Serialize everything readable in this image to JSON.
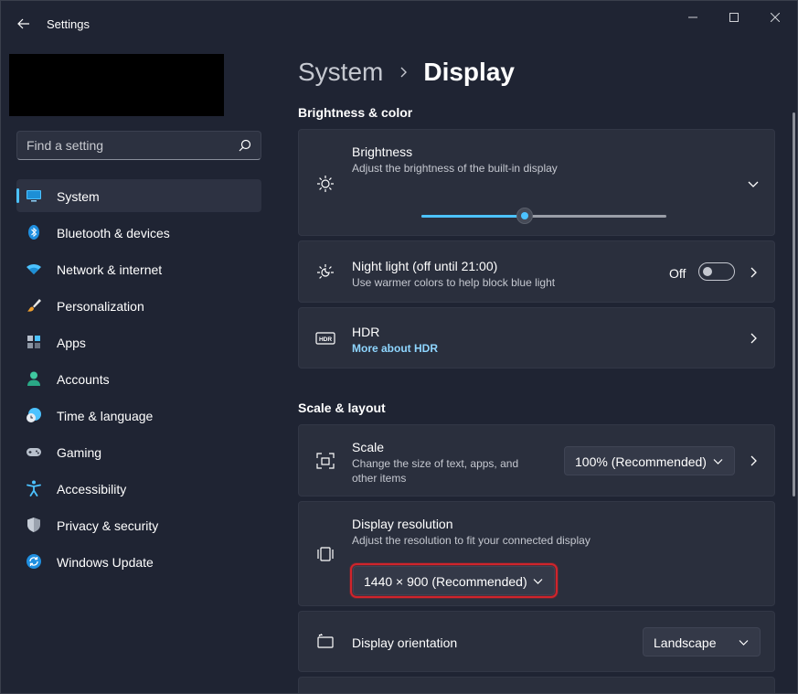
{
  "window": {
    "title": "Settings"
  },
  "search": {
    "placeholder": "Find a setting"
  },
  "sidebar": {
    "items": [
      {
        "label": "System",
        "icon": "monitor-icon",
        "active": true
      },
      {
        "label": "Bluetooth & devices",
        "icon": "bluetooth-icon"
      },
      {
        "label": "Network & internet",
        "icon": "wifi-icon"
      },
      {
        "label": "Personalization",
        "icon": "brush-icon"
      },
      {
        "label": "Apps",
        "icon": "apps-icon"
      },
      {
        "label": "Accounts",
        "icon": "person-icon"
      },
      {
        "label": "Time & language",
        "icon": "globe-clock-icon"
      },
      {
        "label": "Gaming",
        "icon": "gamepad-icon"
      },
      {
        "label": "Accessibility",
        "icon": "accessibility-icon"
      },
      {
        "label": "Privacy & security",
        "icon": "shield-icon"
      },
      {
        "label": "Windows Update",
        "icon": "update-icon"
      }
    ]
  },
  "breadcrumb": {
    "parent": "System",
    "current": "Display"
  },
  "brightness_color": {
    "heading": "Brightness & color",
    "brightness": {
      "title": "Brightness",
      "subtitle": "Adjust the brightness of the built-in display",
      "value_fraction": 0.42
    },
    "night_light": {
      "title": "Night light (off until 21:00)",
      "subtitle": "Use warmer colors to help block blue light",
      "state": "Off"
    },
    "hdr": {
      "title": "HDR",
      "link": "More about HDR"
    }
  },
  "scale_layout": {
    "heading": "Scale & layout",
    "scale": {
      "title": "Scale",
      "subtitle": "Change the size of text, apps, and other items",
      "value": "100% (Recommended)"
    },
    "resolution": {
      "title": "Display resolution",
      "subtitle": "Adjust the resolution to fit your connected display",
      "value": "1440 × 900 (Recommended)"
    },
    "orientation": {
      "title": "Display orientation",
      "value": "Landscape"
    }
  },
  "colors": {
    "accent": "#4cc2ff",
    "highlight": "#d0242b"
  }
}
